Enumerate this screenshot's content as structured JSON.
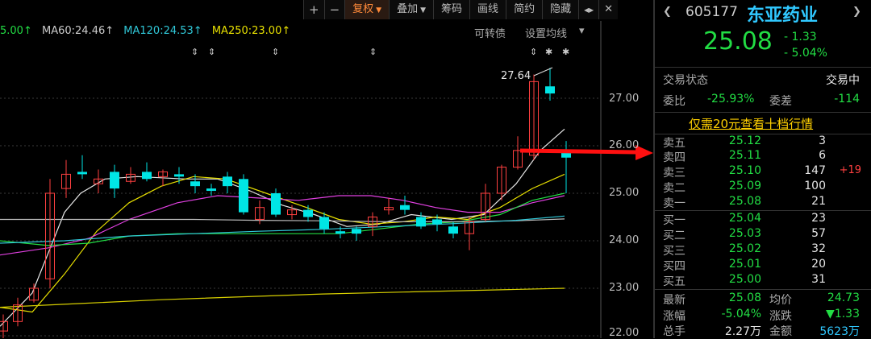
{
  "toolbar": {
    "plus": "+",
    "minus": "−",
    "items": [
      "复权",
      "叠加",
      "筹码",
      "画线",
      "简约",
      "隐藏"
    ],
    "nav": "◂▸",
    "close": "✕"
  },
  "ma_legend": {
    "ma_first": "5.00↑",
    "ma60": "MA60:24.46↑",
    "ma120": "MA120:24.53↑",
    "ma250": "MA250:23.00↑",
    "convertible": "可转债",
    "settings": "设置均线",
    "colors": {
      "ma_first": "#22dd44",
      "ma60": "#cccccc",
      "ma120": "#30c8d8",
      "ma250": "#e8e000"
    }
  },
  "chart": {
    "y_labels": [
      "27.00",
      "26.00",
      "25.00",
      "24.00",
      "23.00",
      "22.00"
    ],
    "high_marker": "27.64",
    "colors": {
      "up": "#ff4040",
      "down": "#00e5e5",
      "grid": "#444444"
    }
  },
  "quote": {
    "code": "605177",
    "name": "东亚药业",
    "price": "25.08",
    "change": "- 1.33",
    "change_pct": "- 5.04%",
    "trade_status_label": "交易状态",
    "trade_status_value": "交易中",
    "weibi_label": "委比",
    "weibi_value": "-25.93%",
    "weicha_label": "委差",
    "weicha_value": "-114",
    "promo": "仅需20元查看十档行情",
    "asks": [
      {
        "label": "卖五",
        "price": "25.12",
        "vol": "3",
        "delta": ""
      },
      {
        "label": "卖四",
        "price": "25.11",
        "vol": "6",
        "delta": ""
      },
      {
        "label": "卖三",
        "price": "25.10",
        "vol": "147",
        "delta": "+19"
      },
      {
        "label": "卖二",
        "price": "25.09",
        "vol": "100",
        "delta": ""
      },
      {
        "label": "卖一",
        "price": "25.08",
        "vol": "21",
        "delta": ""
      }
    ],
    "bids": [
      {
        "label": "买一",
        "price": "25.04",
        "vol": "23"
      },
      {
        "label": "买二",
        "price": "25.03",
        "vol": "57"
      },
      {
        "label": "买三",
        "price": "25.02",
        "vol": "32"
      },
      {
        "label": "买四",
        "price": "25.01",
        "vol": "20"
      },
      {
        "label": "买五",
        "price": "25.00",
        "vol": "31"
      }
    ],
    "stats": [
      {
        "l1": "最新",
        "v1": "25.08",
        "l2": "均价",
        "v2": "24.73"
      },
      {
        "l1": "涨幅",
        "v1": "-5.04%",
        "l2": "涨跌",
        "v2": "▼1.33"
      },
      {
        "l1": "总手",
        "v1": "2.27万",
        "l2": "金额",
        "v2": "5623万"
      }
    ]
  }
}
